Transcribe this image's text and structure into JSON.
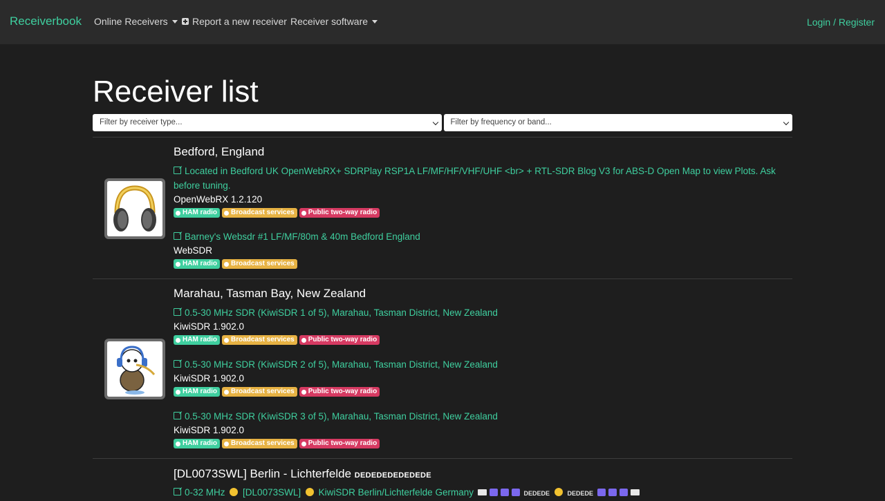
{
  "nav": {
    "brand": "Receiverbook",
    "online": "Online Receivers",
    "report": "Report a new receiver",
    "software": "Receiver software",
    "login": "Login / Register"
  },
  "page": {
    "title": "Receiver list",
    "filter_type_placeholder": "Filter by receiver type...",
    "filter_freq_placeholder": "Filter by frequency or band..."
  },
  "badges": {
    "ham": "HAM radio",
    "broadcast": "Broadcast services",
    "public": "Public two-way radio"
  },
  "colors": {
    "accent": "#3fcf9f",
    "ham": "#3fcf9f",
    "broadcast": "#e7b243",
    "public": "#d63a62"
  },
  "receivers": [
    {
      "location": "Bedford, England",
      "icon": "headphones-icon",
      "entries": [
        {
          "title": "Located in Bedford UK OpenWebRX+ SDRPlay RSP1A LF/MF/HF/VHF/UHF <br> + RTL-SDR Blog V3 for ABS-D Open Map to view Plots. Ask before tuning.",
          "software": "OpenWebRX 1.2.120"
        },
        {
          "title": "Barney's Websdr #1 LF/MF/80m & 40m Bedford England",
          "software": "WebSDR"
        }
      ]
    },
    {
      "location": "Marahau, Tasman Bay, New Zealand",
      "icon": "kiwi-headphones-icon",
      "entries": [
        {
          "title": "0.5-30 MHz SDR (KiwiSDR 1 of 5), Marahau, Tasman District, New Zealand",
          "software": "KiwiSDR 1.902.0"
        },
        {
          "title": "0.5-30 MHz SDR (KiwiSDR 2 of 5), Marahau, Tasman District, New Zealand",
          "software": "KiwiSDR 1.902.0"
        },
        {
          "title": "0.5-30 MHz SDR (KiwiSDR 3 of 5), Marahau, Tasman District, New Zealand",
          "software": "KiwiSDR 1.902.0"
        }
      ]
    },
    {
      "location": "[DL0073SWL] Berlin - Lichterfelde",
      "location_suffix": "DEDEDEDEDEDEDE",
      "entries": [
        {
          "t1": "0-32 MHz",
          "t2": "[DL0073SWL]",
          "t3": "KiwiSDR Berlin/Lichterfelde Germany",
          "t4": "DEDEDE",
          "t5": "DEDEDE"
        }
      ]
    }
  ]
}
